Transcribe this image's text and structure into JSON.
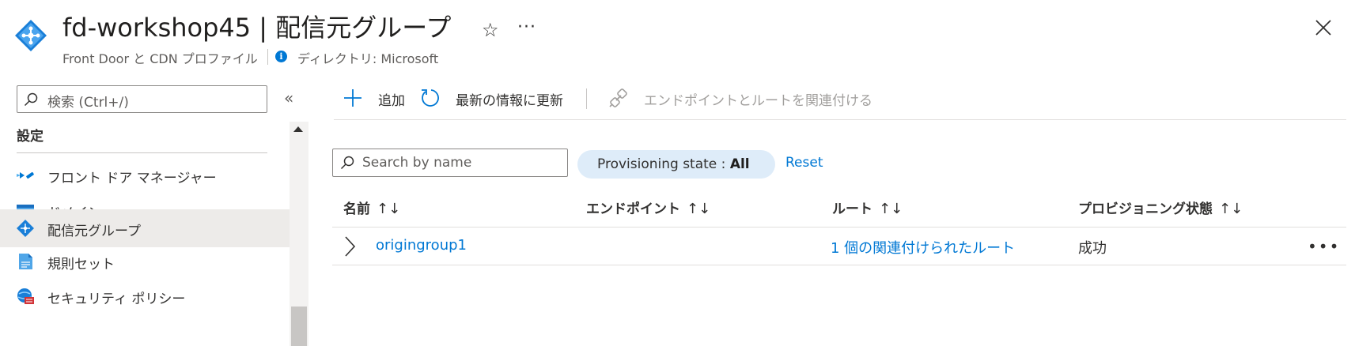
{
  "header": {
    "title": "fd-workshop45 | 配信元グループ",
    "subtitle": "Front Door と CDN プロファイル",
    "directory": "ディレクトリ: Microsoft",
    "star_glyph": "☆",
    "more_glyph": "···"
  },
  "sidebar": {
    "search_placeholder": "検索 (Ctrl+/)",
    "collapse_glyph": "«",
    "section_title": "設定",
    "items": [
      {
        "label": "フロント ドア マネージャー",
        "icon": "front-door-manager-icon"
      },
      {
        "label": "ドメイン",
        "icon": "domain-icon"
      },
      {
        "label": "配信元グループ",
        "icon": "origin-group-icon",
        "active": true
      },
      {
        "label": "規則セット",
        "icon": "rule-set-icon"
      },
      {
        "label": "セキュリティ ポリシー",
        "icon": "security-policy-icon"
      }
    ]
  },
  "toolbar": {
    "add_label": "追加",
    "refresh_label": "最新の情報に更新",
    "associate_label": "エンドポイントとルートを関連付ける"
  },
  "filters": {
    "search_placeholder": "Search by name",
    "pill_label": "Provisioning state : ",
    "pill_value": "All",
    "reset_label": "Reset"
  },
  "table": {
    "sort_glyph": "↑↓",
    "columns": [
      "名前",
      "エンドポイント",
      "ルート",
      "プロビジョニング状態"
    ],
    "rows": [
      {
        "name": "origingroup1",
        "endpoint": "",
        "route": "1 個の関連付けられたルート",
        "state": "成功",
        "more": "•••"
      }
    ]
  },
  "colors": {
    "accent": "#0078d4",
    "active_bg": "#edebe9",
    "pill_bg": "#deecf9"
  }
}
